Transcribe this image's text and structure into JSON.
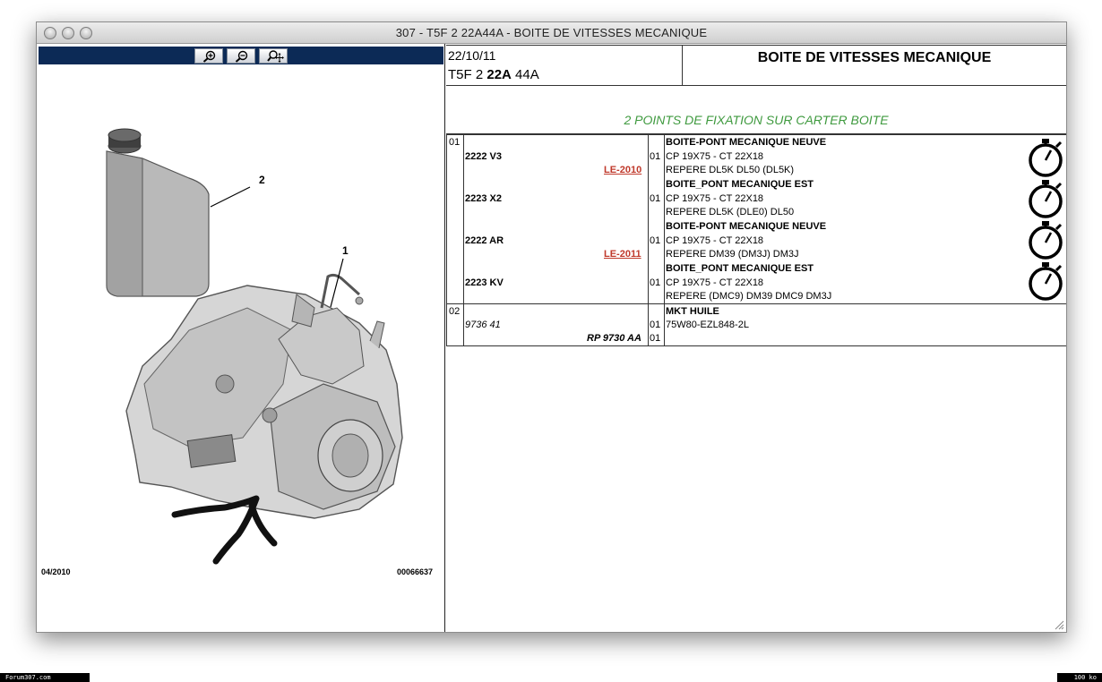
{
  "window": {
    "title": "307 - T5F 2 22A44A - BOITE DE VITESSES MECANIQUE"
  },
  "viewer": {
    "toolbar": {
      "buttons": [
        {
          "name": "zoom-in",
          "icon": "zoom-in-icon"
        },
        {
          "name": "zoom-out",
          "icon": "zoom-out-icon"
        },
        {
          "name": "zoom-pan",
          "icon": "zoom-pan-icon"
        }
      ]
    },
    "callouts": [
      "2",
      "1"
    ],
    "date_code": "04/2010",
    "image_code": "00066637"
  },
  "header": {
    "date": "22/10/11",
    "ref_prefix": "T5F 2 ",
    "ref_bold": "22A",
    "ref_suffix": " 44A",
    "title": "BOITE DE VITESSES MECANIQUE"
  },
  "fixation_note": "2 POINTS DE FIXATION SUR CARTER BOITE",
  "groups": [
    {
      "item": "01",
      "parts": [
        {
          "ref": "2222 V3",
          "le": "LE-2010",
          "qty": "01",
          "name": "BOITE-PONT MECANIQUE NEUVE",
          "line1": "CP 19X75 - CT 22X18",
          "line2": "REPERE DL5K DL50 (DL5K)",
          "icon": "stopwatch-icon"
        },
        {
          "ref": "2223 X2",
          "le": "",
          "qty": "01",
          "name": "BOITE_PONT MECANIQUE EST",
          "line1": "CP 19X75 - CT 22X18",
          "line2": "REPERE DL5K (DLE0) DL50",
          "icon": "stopwatch-icon"
        },
        {
          "ref": "2222 AR",
          "le": "LE-2011",
          "qty": "01",
          "name": "BOITE-PONT MECANIQUE NEUVE",
          "line1": "CP 19X75 - CT 22X18",
          "line2": "REPERE DM39 (DM3J) DM3J",
          "icon": "stopwatch-icon"
        },
        {
          "ref": "2223 KV",
          "le": "",
          "qty": "01",
          "name": "BOITE_PONT MECANIQUE EST",
          "line1": "CP 19X75 - CT 22X18",
          "line2": "REPERE (DMC9) DM39 DMC9 DM3J",
          "icon": "stopwatch-icon"
        }
      ]
    },
    {
      "item": "02",
      "name": "MKT HUILE",
      "ref": "9736 41",
      "qty1": "01",
      "line1": "75W80-EZL848-2L",
      "alt_ref": "RP 9730 AA",
      "qty2": "01"
    }
  ],
  "status": {
    "left": "Forum307.com",
    "right": "100 ko"
  }
}
